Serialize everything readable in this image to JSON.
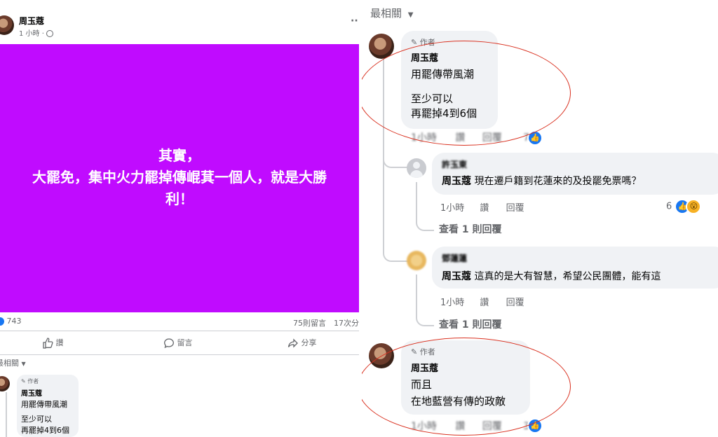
{
  "left": {
    "author_name": "周玉蔻",
    "post_time": "1 小時 · ",
    "more_label": "··",
    "image_text_lines": [
      "其實，",
      "大罷免，集中火力罷掉傳崐萁一個人，就是大勝",
      "利！"
    ],
    "image_bg": "#c00bff",
    "reaction_count": "743",
    "comment_count": "75則留言",
    "share_count": "17次分",
    "actions": [
      "讚",
      "留言",
      "分享"
    ],
    "sort_label": "最相關",
    "comment": {
      "badge": "作者",
      "author": "周玉蔻",
      "lines": [
        "用罷傳帶風潮",
        "至少可以",
        "再罷掉4到6個"
      ]
    }
  },
  "right": {
    "sort_label": "最相關",
    "comments": [
      {
        "badge": "作者",
        "author": "周玉蔻",
        "lines": [
          "用罷傳帶風潮",
          "至少可以",
          "再罷掉4到6個"
        ],
        "time": "1小時",
        "like": "讚",
        "reply": "回覆",
        "reactions": "76"
      },
      {
        "author": "許玉東",
        "mention": "周玉蔻",
        "text": "現在遷戶籍到花蓮來的及投罷免票嗎？",
        "time": "1小時",
        "like": "讚",
        "reply": "回覆",
        "reactions": "6",
        "view_replies": "查看 1 則回覆"
      },
      {
        "author": "鄧蓮蓮",
        "mention": "周玉蔻",
        "text": "這真的是大有智慧，希望公民團體，能有這",
        "time": "1小時",
        "like": "讚",
        "reply": "回覆",
        "view_replies": "查看 1 則回覆"
      },
      {
        "badge": "作者",
        "author": "周玉蔻",
        "lines": [
          "而且",
          "在地藍營有傳的政敵"
        ],
        "time": "1小時",
        "like": "讚",
        "reply": "回覆",
        "reactions": "37"
      }
    ]
  },
  "colors": {
    "accent": "#1877f2",
    "annotation": "#d9301f",
    "bubble": "#f0f2f5",
    "meta_text": "#65676b"
  }
}
